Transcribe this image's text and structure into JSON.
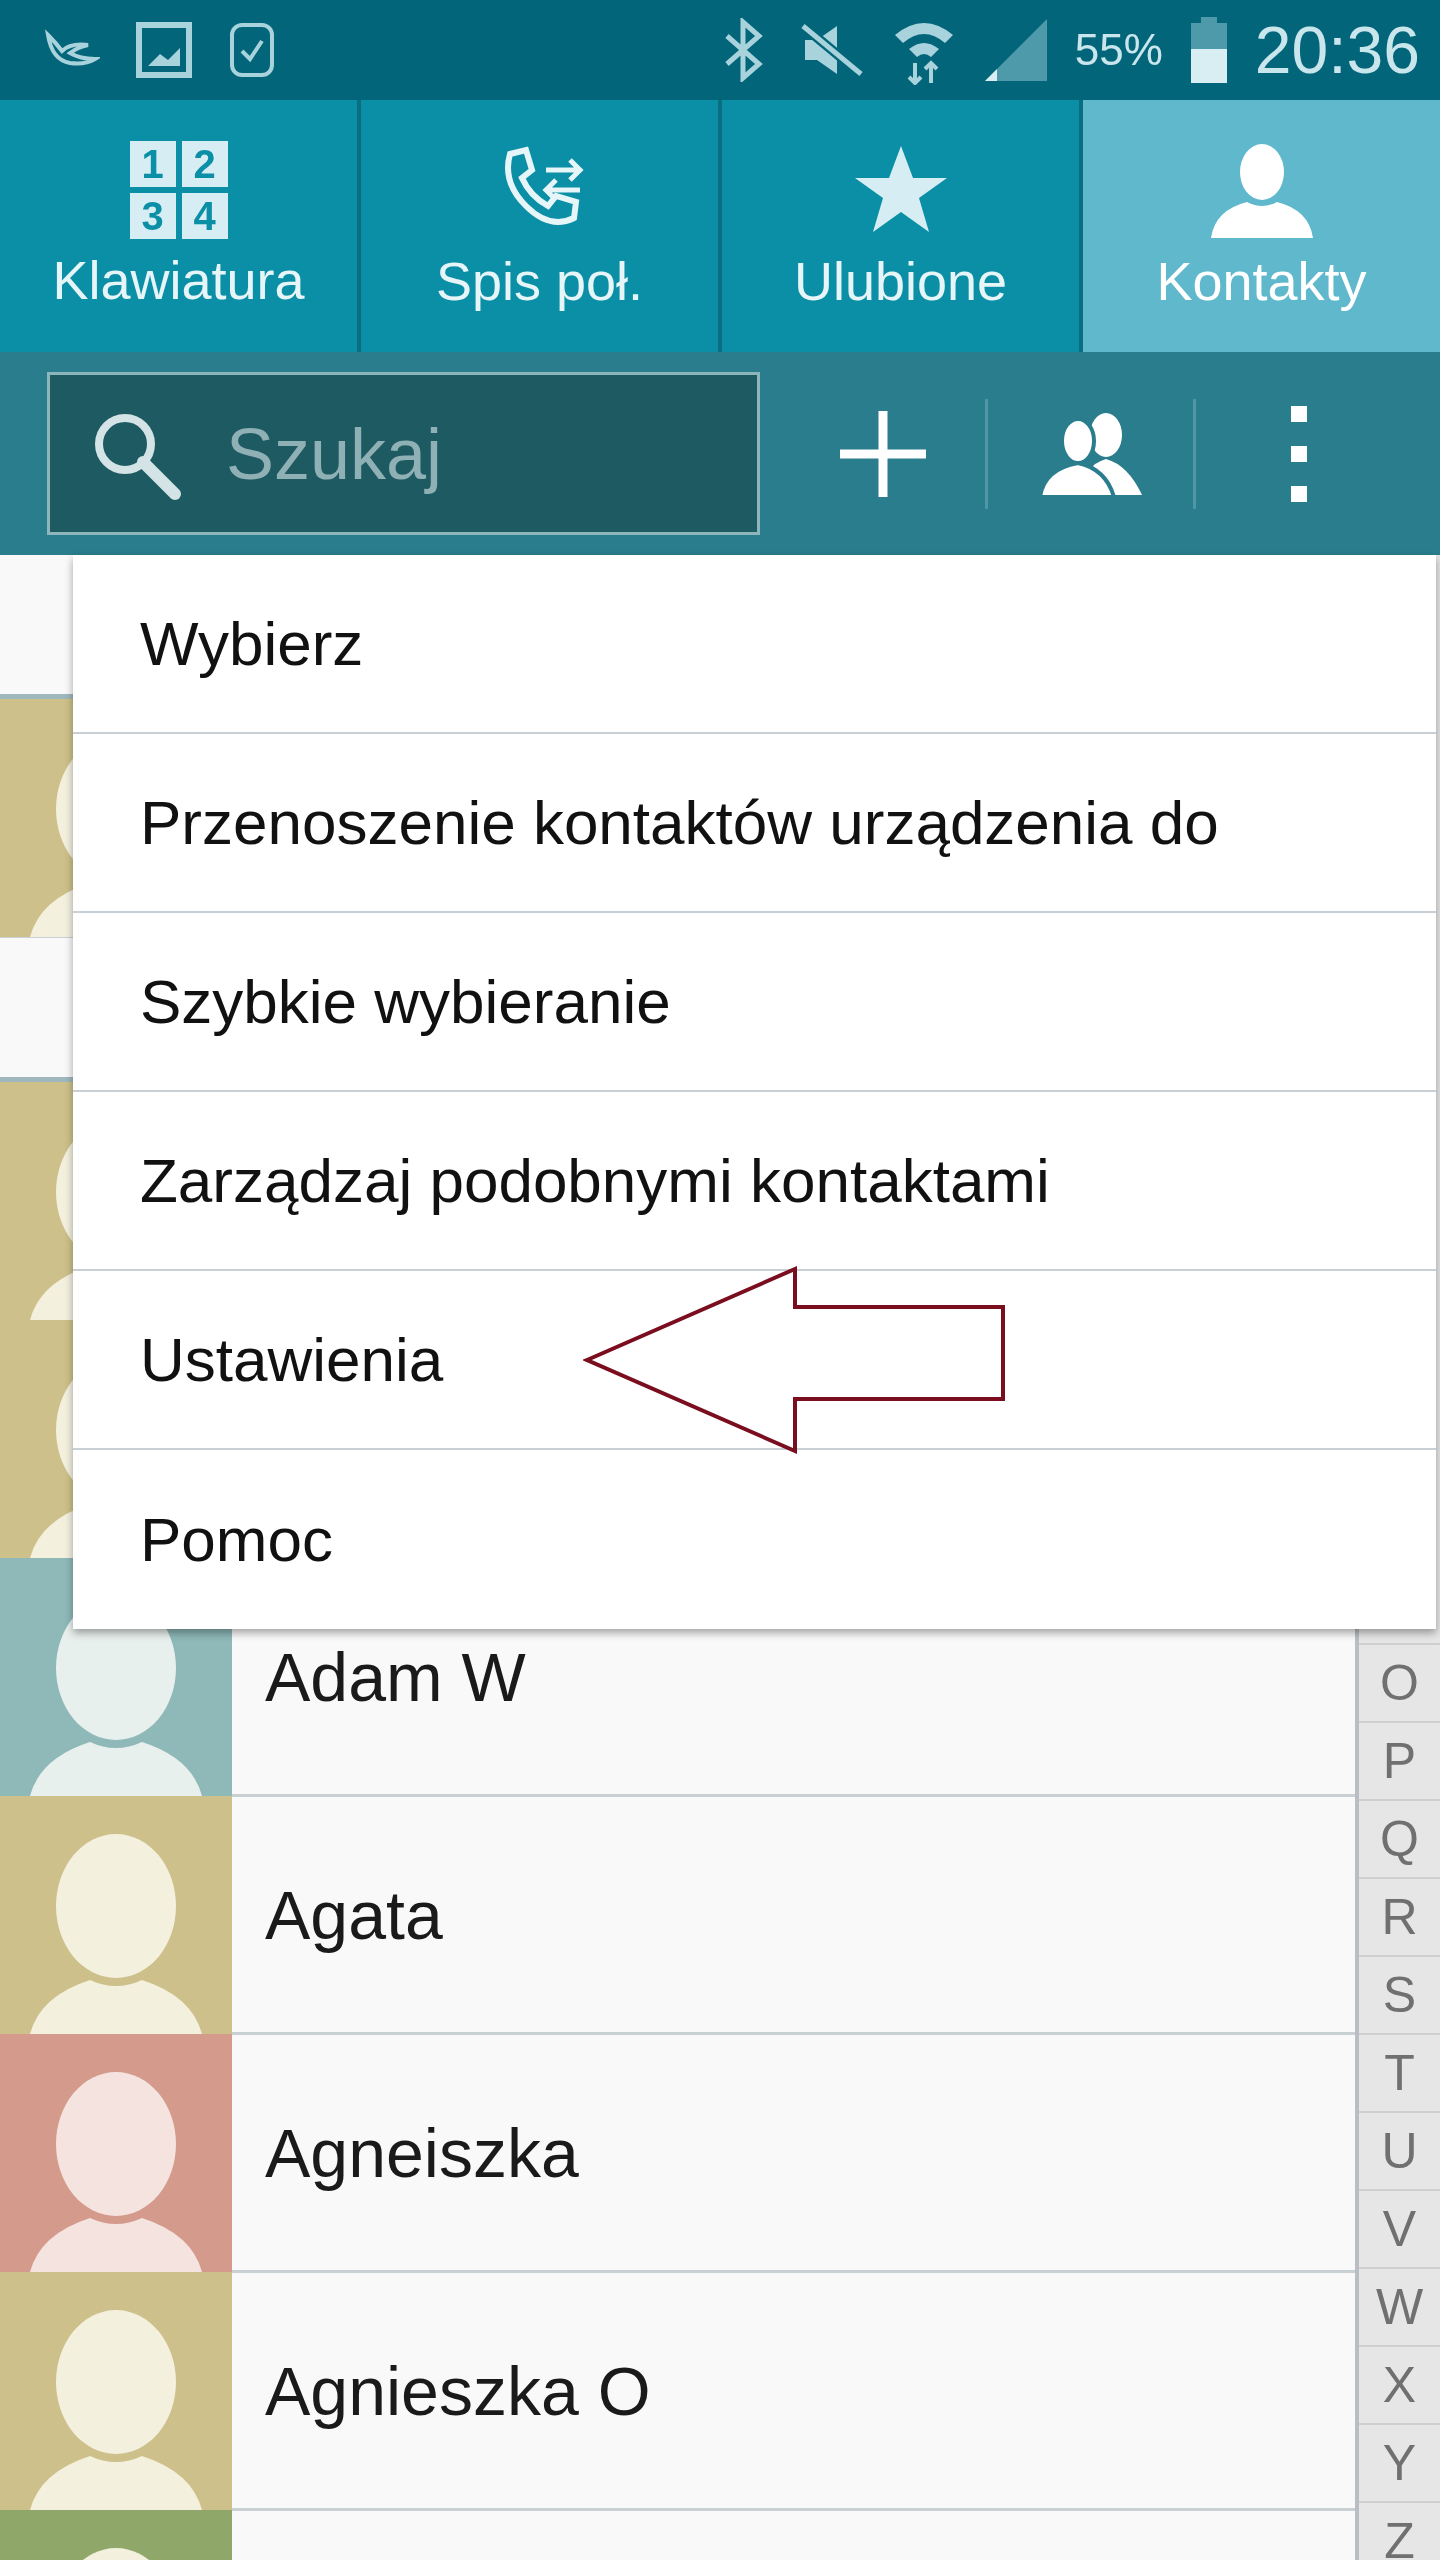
{
  "status_bar": {
    "battery": "55%",
    "time": "20:36"
  },
  "tabs": [
    {
      "label": "Klawiatura",
      "kind": "keypad",
      "keys": [
        "1",
        "2",
        "3",
        "4"
      ],
      "selected": false
    },
    {
      "label": "Spis poł.",
      "kind": "log",
      "selected": false
    },
    {
      "label": "Ulubione",
      "kind": "star",
      "selected": false
    },
    {
      "label": "Kontakty",
      "kind": "person",
      "selected": true
    }
  ],
  "search": {
    "placeholder": "Szukaj"
  },
  "contacts": [
    {
      "kind": "header"
    },
    {
      "kind": "contact",
      "color": "#cdc08a"
    },
    {
      "kind": "header"
    },
    {
      "kind": "contact",
      "color": "#cdc08a"
    },
    {
      "kind": "contact",
      "color": "#cdc08a"
    },
    {
      "kind": "contact",
      "name": "Adam W",
      "color": "#8fb8b8"
    },
    {
      "kind": "contact",
      "name": "Agata",
      "color": "#cdc08a"
    },
    {
      "kind": "contact",
      "name": "Agneiszka",
      "color": "#d49a8c"
    },
    {
      "kind": "contact",
      "name": "Agnieszka O",
      "color": "#cdc08a"
    },
    {
      "kind": "contact",
      "color": "#8fa86a"
    }
  ],
  "index": [
    "O",
    "P",
    "Q",
    "R",
    "S",
    "T",
    "U",
    "V",
    "W",
    "X",
    "Y",
    "Z"
  ],
  "menu": [
    {
      "label": "Wybierz",
      "arrow": false
    },
    {
      "label": "Przenoszenie kontaktów urządzenia do",
      "arrow": false
    },
    {
      "label": "Szybkie wybieranie",
      "arrow": false
    },
    {
      "label": "Zarządzaj podobnymi kontaktami",
      "arrow": false
    },
    {
      "label": "Ustawienia",
      "arrow": true
    },
    {
      "label": "Pomoc",
      "arrow": false
    }
  ]
}
